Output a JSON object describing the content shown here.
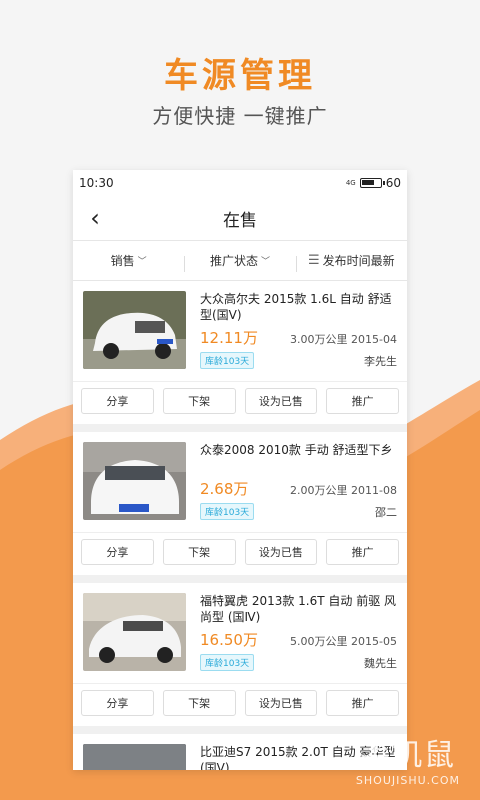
{
  "promo": {
    "headline": "车源管理",
    "subline": "方便快捷 一键推广"
  },
  "status": {
    "time": "10:30",
    "network": "4G",
    "battery": "60"
  },
  "nav": {
    "back": "‹",
    "title": "在售"
  },
  "filters": [
    {
      "label": "销售",
      "icon": "chevron-down"
    },
    {
      "label": "推广状态",
      "icon": "chevron-down"
    },
    {
      "label": "发布时间最新",
      "icon": "list-icon"
    }
  ],
  "cars": [
    {
      "title": "大众高尔夫 2015款 1.6L 自动 舒适型(国Ⅴ)",
      "price": "12.11万",
      "mileage_year": "3.00万公里 2015-04",
      "stock_age": "库龄103天",
      "owner": "李先生",
      "color": "#e8e8e8"
    },
    {
      "title": "众泰2008 2010款 手动 舒适型下乡",
      "price": "2.68万",
      "mileage_year": "2.00万公里 2011-08",
      "stock_age": "库龄103天",
      "owner": "邵二",
      "color": "#ededed"
    },
    {
      "title": "福特翼虎 2013款 1.6T 自动 前驱 风尚型 (国Ⅳ)",
      "price": "16.50万",
      "mileage_year": "5.00万公里 2015-05",
      "stock_age": "库龄103天",
      "owner": "魏先生",
      "color": "#f2f2f2"
    },
    {
      "title": "比亚迪S7 2015款 2.0T 自动 豪华型(国Ⅴ)",
      "price": "",
      "mileage_year": "",
      "stock_age": "",
      "owner": "",
      "color": "#3a3a3a"
    }
  ],
  "actions": {
    "share": "分享",
    "offline": "下架",
    "sold": "设为已售",
    "promote": "推广"
  },
  "watermark": {
    "main": "手机鼠",
    "sub": "SHOUJISHU.COM"
  },
  "colors": {
    "accent": "#f08a24",
    "badge": "#2aaad8"
  }
}
